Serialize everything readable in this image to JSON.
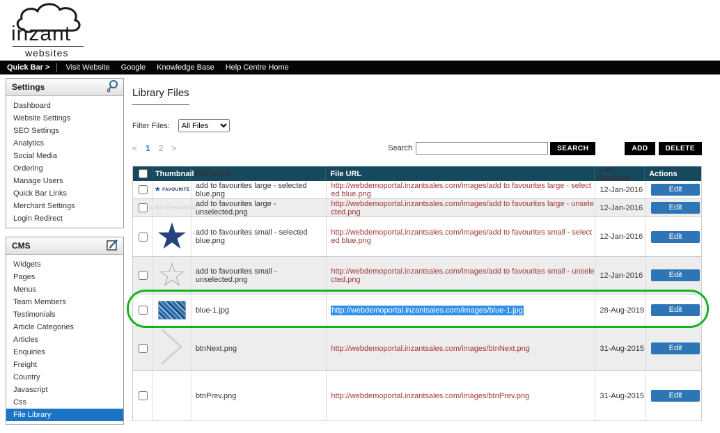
{
  "logo": {
    "brand": "inzant",
    "tagline": "websites"
  },
  "navbar": {
    "items": [
      "Quick Bar >",
      "Visit Website",
      "Google",
      "Knowledge Base",
      "Help Centre Home"
    ]
  },
  "sidebar": {
    "panels": [
      {
        "title": "Settings",
        "icon": "settings-search-icon",
        "items": [
          "Dashboard",
          "Website Settings",
          "SEO Settings",
          "Analytics",
          "Social Media",
          "Ordering",
          "Manage Users",
          "Quick Bar Links",
          "Merchant Settings",
          "Login Redirect"
        ]
      },
      {
        "title": "CMS",
        "icon": "edit-icon",
        "items": [
          "Widgets",
          "Pages",
          "Menus",
          "Team Members",
          "Testimonials",
          "Article Categories",
          "Articles",
          "Enquiries",
          "Freight",
          "Country",
          "Javascript",
          "Css",
          "File Library"
        ],
        "selected_item": "File Library"
      }
    ]
  },
  "main": {
    "title": "Library Files",
    "filter": {
      "label": "Filter Files:",
      "selected": "All Files"
    },
    "pagination": {
      "prev": "<",
      "pages": [
        "1",
        "2"
      ],
      "active": "1",
      "next": ">"
    },
    "search": {
      "label": "Search",
      "value": "",
      "button": "SEARCH"
    },
    "buttons": {
      "add": "ADD",
      "delete": "DELETE"
    },
    "table": {
      "headers": {
        "thumbnail": "Thumbnail",
        "file_name": "File Name",
        "file_url": "File URL",
        "last_modified": "Last Modified",
        "actions": "Actions"
      },
      "edit_label": "Edit",
      "rows": [
        {
          "thumb_icon": "favourite-star-badge",
          "thumb_label": "FAVOURITE",
          "name": "add to favourites large - selected blue.png",
          "url": "http://webdemoportal.inzantsales.com/images/add to favourites large - selected blue.png",
          "modified": "12-Jan-2016"
        },
        {
          "thumb_icon": "add-to-favourites-badge",
          "thumb_label": "ADD TO FAVOURITES",
          "name": "add to favourites large - unselected.png",
          "url": "http://webdemoportal.inzantsales.com/images/add to favourites large - unselected.png",
          "modified": "12-Jan-2016"
        },
        {
          "thumb_icon": "star-filled-blue",
          "name": "add to favourites small - selected blue.png",
          "url": "http://webdemoportal.inzantsales.com/images/add to favourites small - selected blue.png",
          "modified": "12-Jan-2016"
        },
        {
          "thumb_icon": "star-outline-grey",
          "name": "add to favourites small - unselected.png",
          "url": "http://webdemoportal.inzantsales.com/images/add to favourites small - unselected.png",
          "modified": "12-Jan-2016"
        },
        {
          "thumb_icon": "blue-image-thumbnail",
          "name": "blue-1.jpg",
          "url": "http://webdemoportal.inzantsales.com/images/blue-1.jpg",
          "modified": "28-Aug-2019",
          "url_selected": true,
          "highlighted": true
        },
        {
          "thumb_icon": "chevron-right-grey",
          "name": "btnNext.png",
          "url": "http://webdemoportal.inzantsales.com/images/btnNext.png",
          "modified": "31-Aug-2015"
        },
        {
          "thumb_icon": "blank",
          "name": "btnPrev.png",
          "url": "http://webdemoportal.inzantsales.com/images/btnPrev.png",
          "modified": "31-Aug-2015"
        }
      ]
    },
    "annotation": {
      "highlight_color": "#14b31e"
    }
  }
}
